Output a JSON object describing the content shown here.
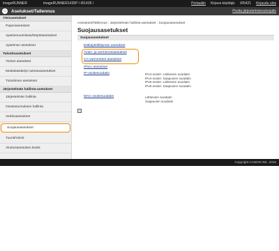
{
  "topbar": {
    "brand": "imageRUNNER",
    "device": "imageRUNNER1435P / iR1435 /",
    "portal": "Portaaliin",
    "user_label": "Kirjava käyttäjä:",
    "user_name": "iR5421",
    "logout": "Kirjaudu ulos"
  },
  "titlebar": {
    "title": "Asetukset/Tallennus",
    "mail": "Posita järjestelmänvalvojalle"
  },
  "sidebar": {
    "sections": [
      {
        "header": "Yleisasetukset",
        "items": [
          "Paperiasetukset",
          "Ajastinmuotoilusa/Näyttöasetukset",
          "Ajastimen asetukset"
        ]
      },
      {
        "header": "Tulostinasetukset",
        "items": [
          "Yleiset asetukset",
          "Mediakäsittelyn tulostusasetukset",
          "Tulostimen asetukset"
        ]
      },
      {
        "header": "Järjestelmän hallinta-asetukset",
        "items": [
          "Järjestelmän hallinta",
          "Osastotunnuksen hallinta",
          "Verkkoasetukset",
          "Suojausasetukset",
          "Tuonti/Vienti",
          "Alustusasetusten tiedot"
        ]
      }
    ],
    "selected": "Suojausasetukset"
  },
  "main": {
    "breadcrumb": "Asetukset/Tallennus : Järjestelmän hallinta-asetukset : Suojausasetukset",
    "title": "Suojausasetukset",
    "panel_header": "Suojausasetukset",
    "links": {
      "ethernet": "Etäkäyttöliittymän asetukset",
      "keys": "Avain- ja varmenneasetukset",
      "ca": "CA-varmenteet asetukset",
      "ipsec": "IPsec-asetukset",
      "ipfilter": "IP-osoitesuodatin",
      "mac": "MAC-osoitesuodatin"
    },
    "ip_desc": [
      "IPv4-osoite: Lähtevien suodatin",
      "IPv4-osoite: Saapuvien suodatin",
      "IPv6-osoite: Lähtevien suodatin",
      "IPv6-osoite: Saapuvien suodatin"
    ],
    "mac_desc": [
      "Lähtevien suodatin",
      "Saapuvien suodatin"
    ]
  },
  "footer": {
    "copyright": "Copyright CANON INC. 2015"
  },
  "colors": {
    "highlight": "#f08a00",
    "link": "#1a3f8f",
    "dark_bar": "#1a1a1a"
  }
}
